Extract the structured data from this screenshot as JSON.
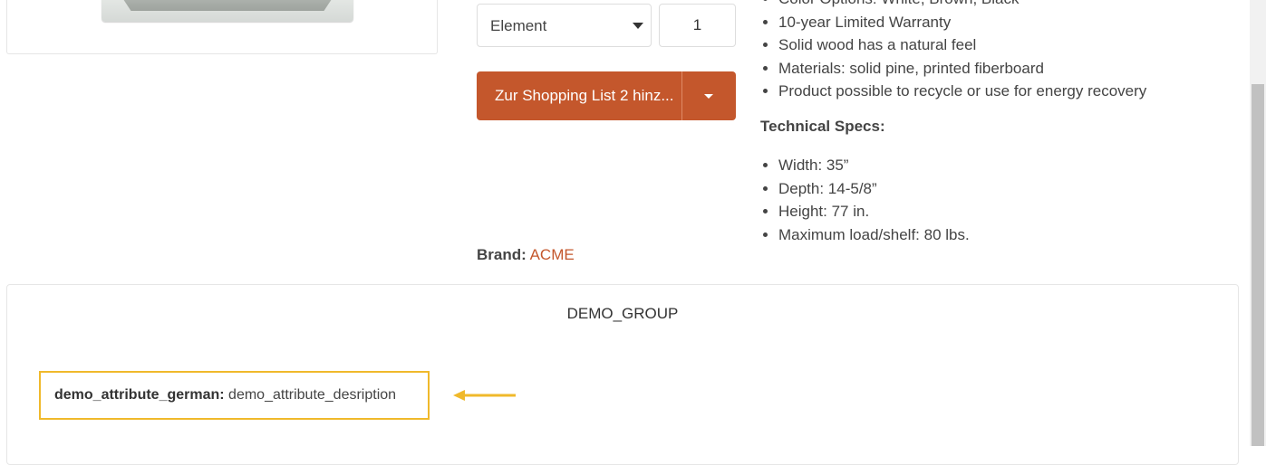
{
  "product_form": {
    "unit_select_value": "Element",
    "quantity_value": "1",
    "add_button_label": "Zur Shopping List 2 hinz...",
    "brand_label": "Brand:",
    "brand_value": "ACME"
  },
  "features": [
    "Color Options: White, Brown, Black",
    "10-year Limited Warranty",
    "Solid wood has a natural feel",
    "Materials: solid pine, printed fiberboard",
    "Product possible to recycle or use for energy recovery"
  ],
  "technical_specs": {
    "title": "Technical Specs:",
    "items": [
      "Width: 35”",
      "Depth: 14-5/8”",
      "Height: 77 in.",
      "Maximum load/shelf: 80 lbs."
    ]
  },
  "attribute_group": {
    "title": "DEMO_GROUP",
    "attribute_name": "demo_attribute_german:",
    "attribute_value": "demo_attribute_desription"
  },
  "colors": {
    "accent": "#c4572c",
    "highlight_border": "#f0b92b"
  }
}
